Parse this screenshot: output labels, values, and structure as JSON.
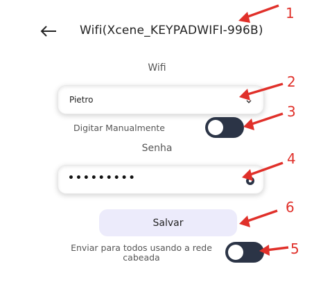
{
  "header": {
    "title": "Wifi(Xcene_KEYPADWIFI-996B)"
  },
  "wifi_section": {
    "label": "Wifi",
    "selected_network": "Pietro"
  },
  "manual_entry": {
    "label": "Digitar Manualmente",
    "toggle_state": "off"
  },
  "password_section": {
    "label": "Senha",
    "masked_value": "•••••••••"
  },
  "actions": {
    "save_label": "Salvar"
  },
  "send_all": {
    "label": "Enviar para todos usando a rede cabeada",
    "toggle_state": "off"
  },
  "annotations": [
    "1",
    "2",
    "3",
    "4",
    "5",
    "6"
  ],
  "colors": {
    "toggle_off": "#2b3446",
    "save_button_bg": "#ecebfb",
    "annotation_red": "#e0302a"
  }
}
